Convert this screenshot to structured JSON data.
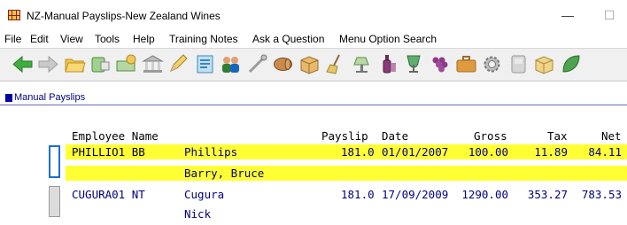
{
  "window": {
    "title": "NZ-Manual Payslips-New Zealand Wines",
    "minimize_glyph": "—",
    "maximize_glyph": "☐"
  },
  "menu": [
    "File",
    "Edit",
    "View",
    "Tools",
    "Help",
    "Training Notes",
    "Ask a Question",
    "Menu Option Search"
  ],
  "toolbar": {
    "icons": [
      "back-arrow-icon",
      "forward-arrow-icon",
      "folder-icon",
      "phone-order-icon",
      "payment-icon",
      "bank-icon",
      "pencil-icon",
      "document-icon",
      "people-icon",
      "tools-icon",
      "barrel-icon",
      "package-icon",
      "broom-icon",
      "lamp-icon",
      "bottle-icon",
      "grapes-icon",
      "briefcase-icon",
      "gear-icon",
      "window-icon",
      "box-icon",
      "leaf-icon"
    ]
  },
  "form": {
    "title": "Manual Payslips"
  },
  "grid": {
    "headers": {
      "employee": "Employee Name",
      "payslip": "Payslip",
      "date": "Date",
      "gross": "Gross",
      "tax": "Tax",
      "net": "Net"
    },
    "rows": [
      {
        "code": "PHILLIO1 BB",
        "surname": "Phillips",
        "given": "Barry, Bruce",
        "payslip": "181.0",
        "date": "01/01/2007",
        "gross": "100.00",
        "tax": "11.89",
        "net": "84.11",
        "selected": true
      },
      {
        "code": "CUGURA01 NT",
        "surname": "Cugura",
        "given": "Nick",
        "payslip": "181.0",
        "date": "17/09/2009",
        "gross": "1290.00",
        "tax": "353.27",
        "net": "783.53",
        "selected": false
      }
    ]
  },
  "colors": {
    "highlight": "#ffff33",
    "selector_active": "#1a6fd1",
    "form_title": "#000080",
    "grid_text_blue": "#000080"
  }
}
